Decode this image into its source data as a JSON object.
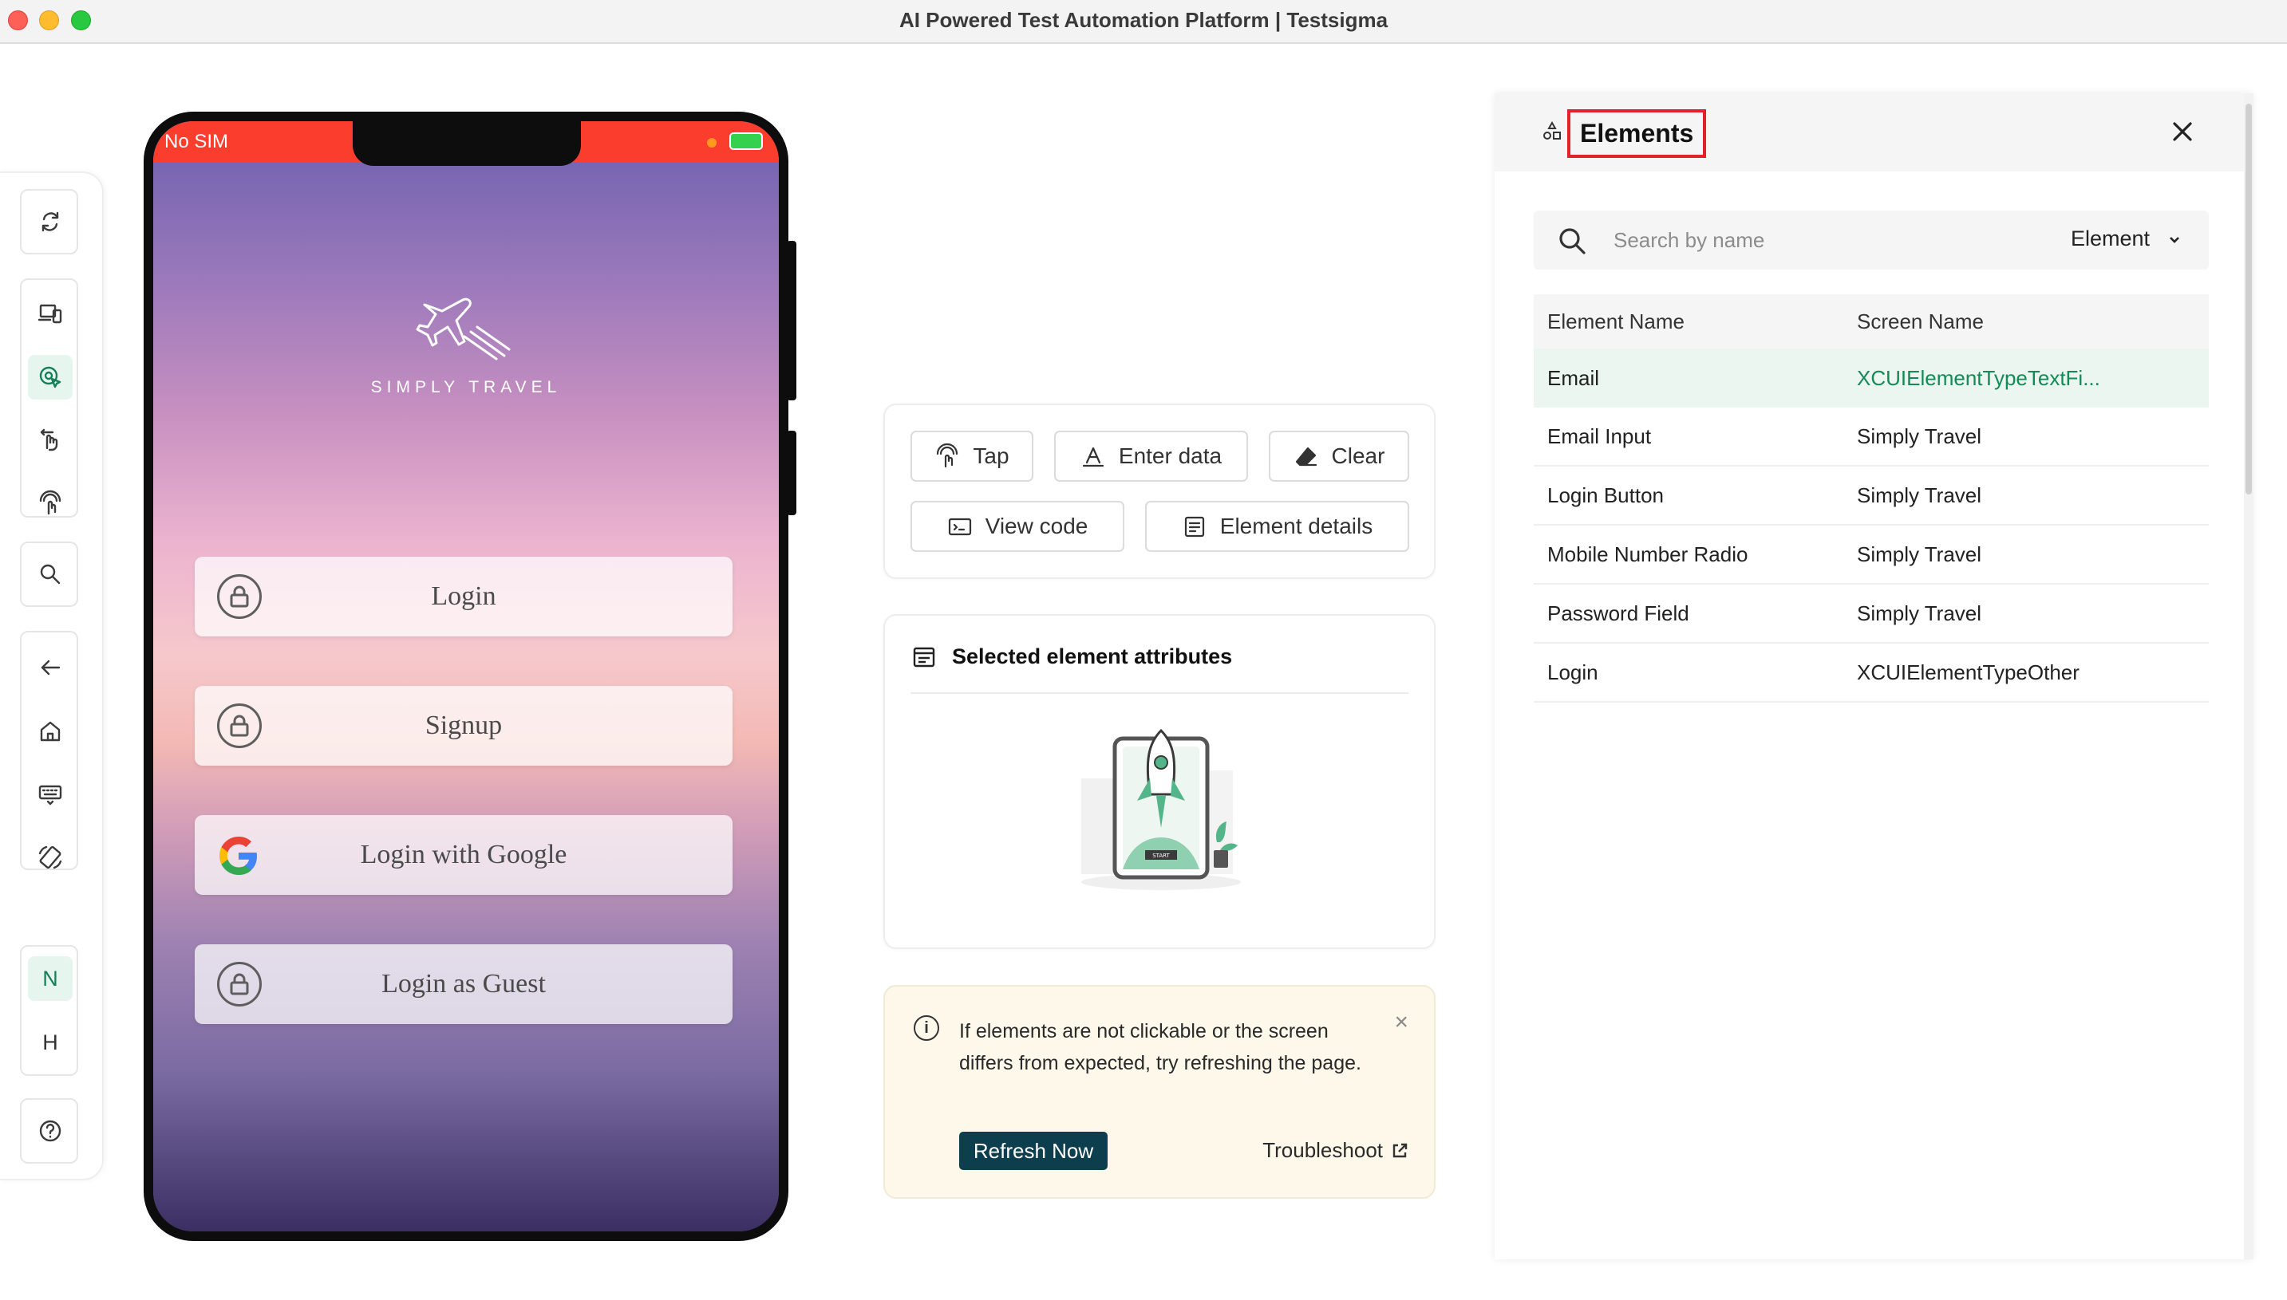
{
  "window": {
    "title": "AI Powered Test Automation Platform | Testsigma"
  },
  "toolbar": {
    "letters": {
      "n": "N",
      "h": "H"
    }
  },
  "device": {
    "status": {
      "carrier": "No SIM"
    },
    "app": {
      "brand": "SIMPLY TRAVEL",
      "buttons": [
        "Login",
        "Signup",
        "Login with Google",
        "Login as Guest"
      ]
    }
  },
  "actions": {
    "tap": "Tap",
    "enter_data": "Enter data",
    "clear": "Clear",
    "view_code": "View code",
    "element_details": "Element details"
  },
  "attributes": {
    "title": "Selected element attributes",
    "illustration_label": "START"
  },
  "notice": {
    "text": "If elements are not clickable or the screen differs from expected, try refreshing the page.",
    "refresh_label": "Refresh Now",
    "troubleshoot_label": "Troubleshoot"
  },
  "elements_panel": {
    "title": "Elements",
    "search_placeholder": "Search by name",
    "filter_value": "Element",
    "columns": {
      "name": "Element Name",
      "screen": "Screen Name"
    },
    "rows": [
      {
        "name": "Email",
        "screen": "XCUIElementTypeTextFi...",
        "selected": true
      },
      {
        "name": "Email Input",
        "screen": "Simply Travel",
        "selected": false
      },
      {
        "name": "Login Button",
        "screen": "Simply Travel",
        "selected": false
      },
      {
        "name": "Mobile Number Radio",
        "screen": "Simply Travel",
        "selected": false
      },
      {
        "name": "Password Field",
        "screen": "Simply Travel",
        "selected": false
      },
      {
        "name": "Login",
        "screen": "XCUIElementTypeOther",
        "selected": false
      }
    ]
  },
  "colors": {
    "accent": "#147f5a",
    "title_highlight": "#e3212b",
    "refresh_button": "#0d3e4e",
    "status_bar": "#fb3d2e"
  }
}
